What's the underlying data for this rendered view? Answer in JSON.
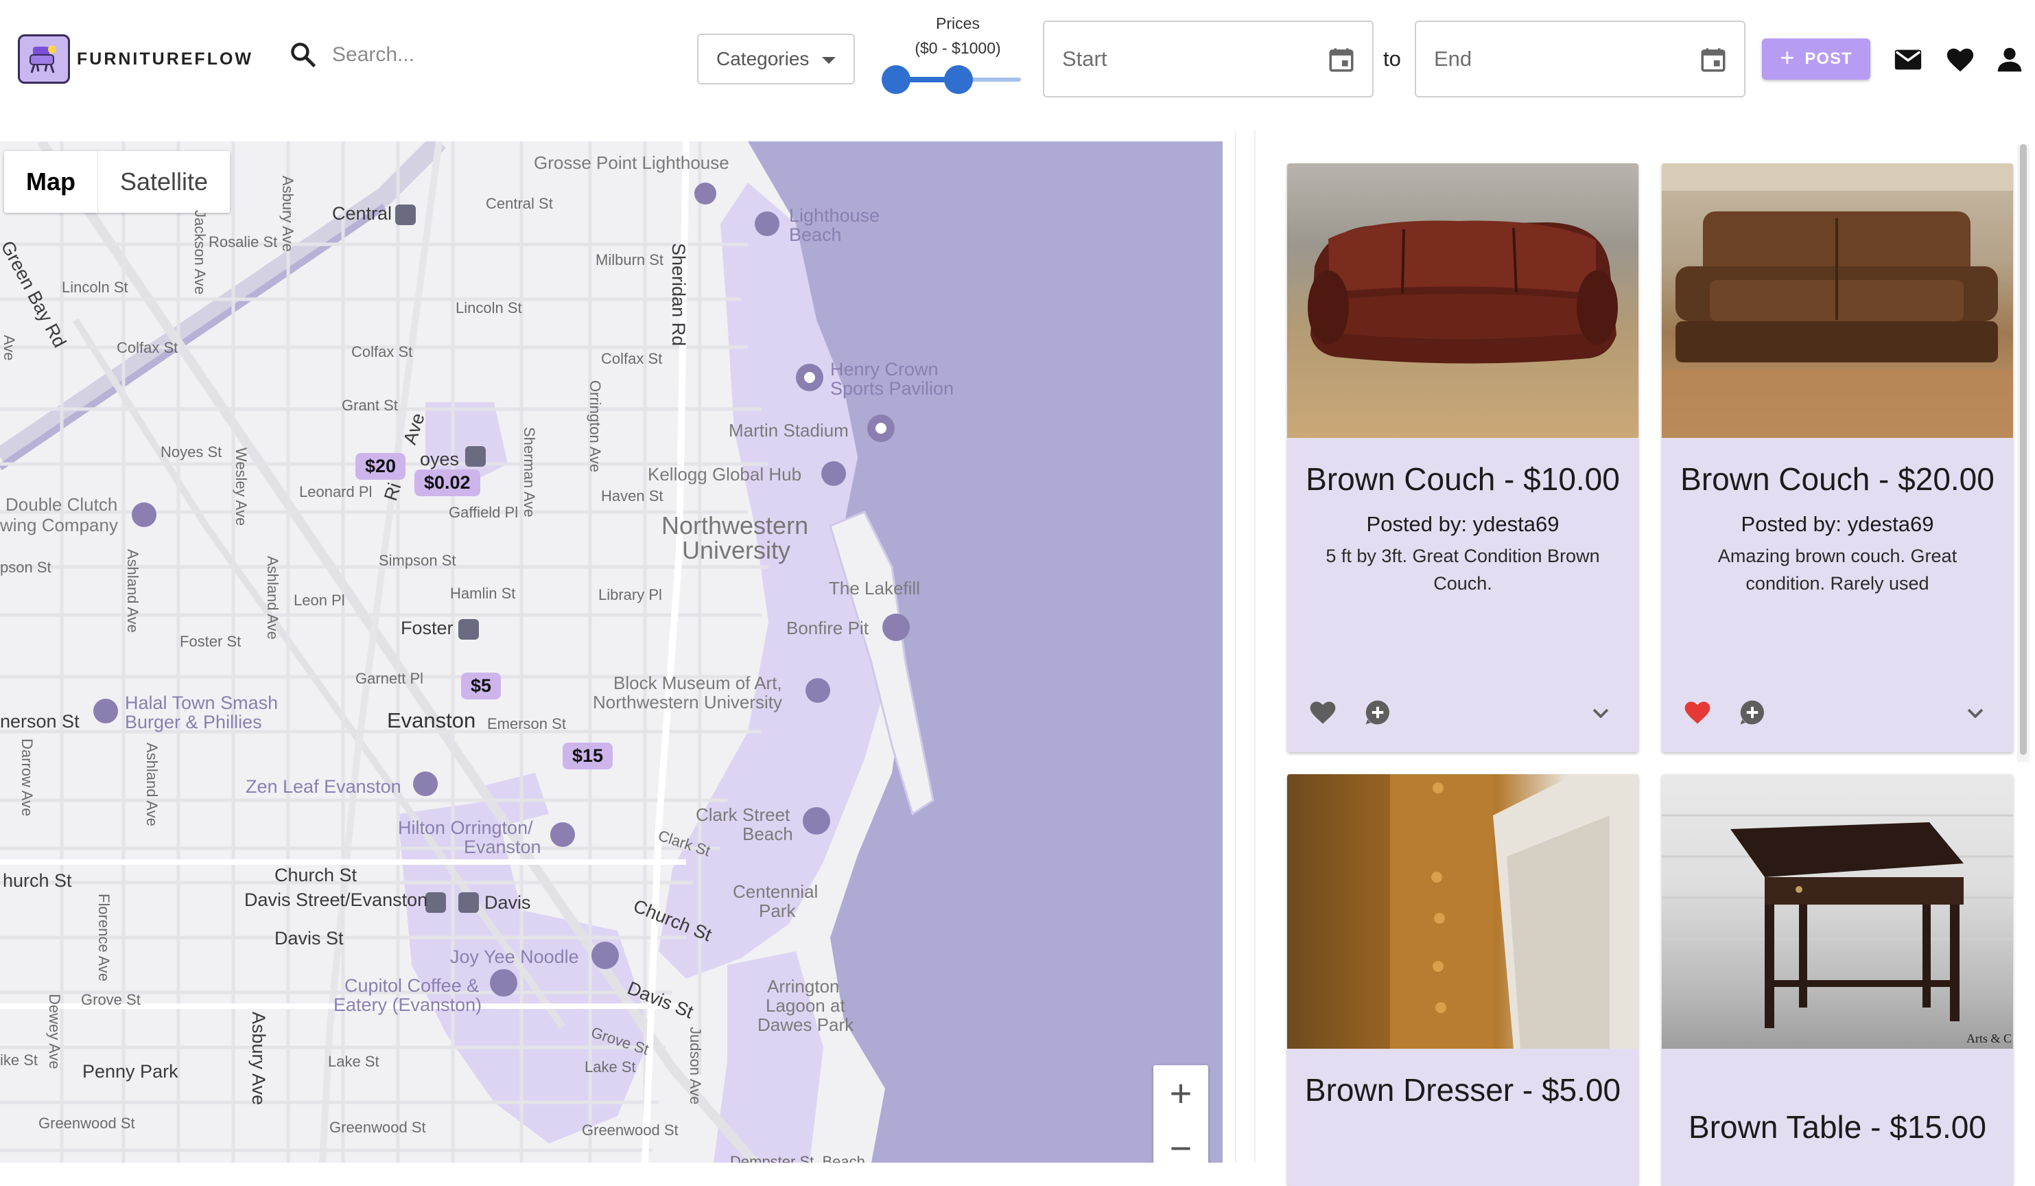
{
  "header": {
    "logo_text": "FURNITUREFLOW",
    "logo_icon": "armchair-logo-icon",
    "search_placeholder": "Search...",
    "categories_label": "Categories",
    "prices_title": "Prices",
    "prices_range": "($0 - $1000)",
    "price_slider": {
      "min": 0,
      "max": 1000,
      "low_fraction": 0.0,
      "high_fraction": 0.5
    },
    "start_placeholder": "Start",
    "to_label": "to",
    "end_placeholder": "End",
    "post_label": "POST",
    "icons": [
      "search-icon",
      "calendar-icon",
      "mail-icon",
      "heart-icon",
      "account-icon"
    ],
    "accent_color": "#b79cf3",
    "slider_color": "#2f6fd0"
  },
  "map": {
    "tab_map": "Map",
    "tab_satellite": "Satellite",
    "price_tags": [
      "$20",
      "$0.02",
      "$5",
      "$15"
    ],
    "labels": {
      "grosse_point": "Grosse Point Lighthouse",
      "lighthouse_beach_1": "Lighthouse",
      "lighthouse_beach_2": "Beach",
      "central": "Central",
      "central_st_1": "Central St",
      "rosalie": "Rosalie St",
      "lincoln_1": "Lincoln St",
      "lincoln_2": "Lincoln St",
      "milburn": "Milburn St",
      "sheridan": "Sheridan Rd",
      "green_bay": "Green Bay Rd",
      "colfax_1": "Colfax St",
      "colfax_2": "Colfax St",
      "colfax_3": "Colfax St",
      "henry_crown_1": "Henry Crown",
      "henry_crown_2": "Sports Pavilion",
      "grant": "Grant St",
      "martin": "Martin Stadium",
      "noyes_st": "Noyes St",
      "noyes": "oyes",
      "kellogg": "Kellogg Global Hub",
      "leonard": "Leonard Pl",
      "haven": "Haven St",
      "double_clutch_1": "Double Clutch",
      "double_clutch_2": "wing Company",
      "gaffield": "Gaffield Pl",
      "northwestern_1": "Northwestern",
      "northwestern_2": "University",
      "simpson_1": "Simpson St",
      "simpson_2": "pson St",
      "hamlin": "Hamlin St",
      "library": "Library Pl",
      "lakefill": "The Lakefill",
      "leon": "Leon Pl",
      "foster": "Foster",
      "foster_st": "Foster St",
      "bonfire": "Bonfire Pit",
      "garnett": "Garnett Pl",
      "block_1": "Block Museum of Art,",
      "block_2": "Northwestern University",
      "halal_1": "Halal Town Smash",
      "halal_2": "Burger & Phillies",
      "evanston": "Evanston",
      "emerson": "Emerson St",
      "emerson_left": "nerson St",
      "zen_leaf": "Zen Leaf Evanston",
      "hilton_1": "Hilton Orrington/",
      "hilton_2": "Evanston",
      "clark_1": "Clark Street",
      "clark_2": "Beach",
      "clark_st": "Clark St",
      "church_left": "hurch St",
      "church_st": "Church St",
      "church_st_2": "Church St",
      "davis_station": "Davis Street/Evanston",
      "davis": "Davis",
      "centennial_1": "Centennial",
      "centennial_2": "Park",
      "davis_st": "Davis St",
      "davis_st_2": "Davis St",
      "joy_yee": "Joy Yee Noodle",
      "cupitol_1": "Cupitol Coffee &",
      "cupitol_2": "Eatery (Evanston)",
      "arrington_1": "Arrington",
      "arrington_2": "Lagoon at",
      "arrington_3": "Dawes Park",
      "grove_1": "Grove St",
      "grove_2": "Grove St",
      "penny": "Penny Park",
      "lake_1": "Lake St",
      "lake_2": "Lake St",
      "lake_3": "ike St",
      "greenwood_1": "Greenwood St",
      "greenwood_2": "Greenwood St",
      "greenwood_3": "Greenwood St",
      "asbury_ave": "Asbury Ave",
      "jackson": "Jackson Ave",
      "wesley": "Wesley Ave",
      "ashland_1": "Ashland Ave",
      "ashland_2": "Ashland Ave",
      "darrow": "Darrow Ave",
      "florence": "Florence Ave",
      "dewey": "Dewey Ave",
      "sherman": "Sherman Ave",
      "orrington": "Orrington Ave",
      "judson": "Judson Ave",
      "ridge": "Ri",
      "ridge_ave": "Ave",
      "ave_left": "Ave",
      "dempster": "Dempster St. Beach",
      "asbury_2": "Asbury Ave"
    },
    "zoom_in": "+",
    "zoom_out": "−",
    "lake_color": "#aeaad4",
    "campus_color": "#ddd4f3"
  },
  "listings": [
    {
      "title": "Brown Couch - $10.00",
      "poster": "Posted by: ydesta69",
      "description": "5 ft by 3ft. Great Condition Brown Couch.",
      "favorited": false
    },
    {
      "title": "Brown Couch - $20.00",
      "poster": "Posted by: ydesta69",
      "description": "Amazing brown couch. Great condition. Rarely used",
      "favorited": true
    },
    {
      "title": "Brown Dresser - $5.00",
      "poster": "",
      "description": "",
      "favorited": false
    },
    {
      "title": "Brown Table - $15.00",
      "poster": "",
      "description": "",
      "favorited": false
    }
  ],
  "photo_caption": "Arts & C"
}
